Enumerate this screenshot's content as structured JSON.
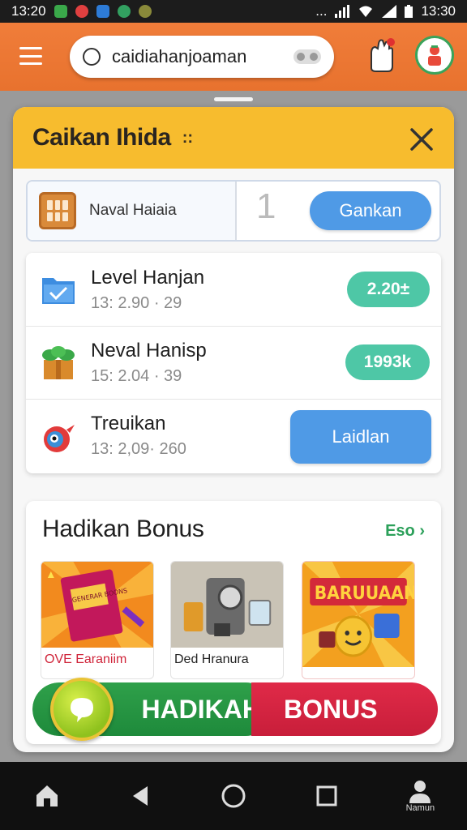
{
  "status_bar": {
    "time_left": "13:20",
    "time_right": "13:30",
    "signal": "..."
  },
  "app_bar": {
    "search_value": "caidiahanjoaman"
  },
  "sheet": {
    "title": "Caikan Ihida",
    "title_glyph": "::",
    "bar": {
      "label": "Naval Haiaia",
      "separator": "1",
      "button": "Gankan"
    },
    "rows": [
      {
        "title": "Level Hanjan",
        "subtitle": "13: 2.90 · 29",
        "action": "2.20±",
        "icon": "folder-check-icon"
      },
      {
        "title": "Neval Hanisp",
        "subtitle": "15: 2.04 · 39",
        "action": "1993k",
        "icon": "gift-box-icon"
      },
      {
        "title": "Treuikan",
        "subtitle": "13: 2,09· 260",
        "action": "Laidlan",
        "icon": "bird-icon"
      }
    ]
  },
  "bonus": {
    "title": "Hadikan Bonus",
    "see_all": "Eso",
    "tiles": [
      {
        "label": "OVE Earaniim",
        "icon": "book-icon",
        "label_color": "#d0253a"
      },
      {
        "label": "Ded Hranura",
        "icon": "coffee-machine-icon",
        "label_color": "#222222"
      },
      {
        "label": "BARUUAAN",
        "icon": "coins-icon",
        "label_color": "#c0253a"
      }
    ],
    "tile_art_text": "GENERAR BOONS"
  },
  "banner": {
    "left_text": "HADIKAH",
    "right_text": "BONUS"
  },
  "nav": {
    "profile_label": "Namun"
  },
  "colors": {
    "app_bar": "#e8722e",
    "sheet_header": "#f7bc2e",
    "accent_blue": "#4f9ae6",
    "pill_green": "#4ec7a6",
    "banner_green": "#1e8a3b",
    "banner_red": "#c81e3a"
  }
}
